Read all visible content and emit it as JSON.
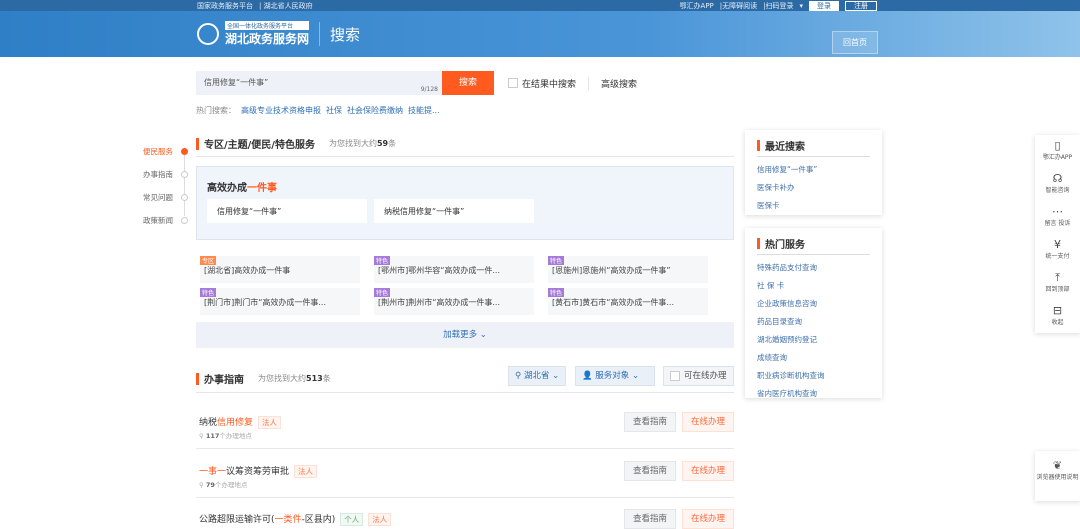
{
  "topbar": {
    "links": [
      "国家政务服务平台",
      "湖北省人民政府"
    ],
    "app": "鄂汇办APP",
    "access": "无障碍阅读",
    "scan": "扫码登录",
    "login": "登录",
    "register": "注册"
  },
  "header": {
    "platform": "全国一体化政务服务平台",
    "site": "湖北政务服务网",
    "page": "搜索",
    "home": "回首页"
  },
  "search": {
    "value": "信用修复“一件事”",
    "count": "9/128",
    "button": "搜索",
    "in_results": "在结果中搜索",
    "advanced": "高级搜索"
  },
  "hot": {
    "label": "热门搜索：",
    "items": [
      "高级专业技术资格申报",
      "社保",
      "社会保险费缴纳",
      "技能提..."
    ]
  },
  "side_nav": [
    "便民服务",
    "办事指南",
    "常见问题",
    "政策新闻"
  ],
  "special": {
    "title": "专区/主题/便民/特色服务",
    "count_pre": "为您找到大约",
    "count": "59",
    "count_suf": "条",
    "banner_title": "高效办成",
    "banner_title_hl": "一件事",
    "cards": [
      "信用修复“一件事”",
      "纳税信用修复“一件事”"
    ],
    "items": [
      {
        "tag": "专区",
        "text": "[湖北省]高效办成一件事"
      },
      {
        "tag": "特色",
        "text": "[鄂州市]鄂州华容“高效办成一件..."
      },
      {
        "tag": "特色",
        "text": "[恩施州]恩施州“高效办成一件事”"
      },
      {
        "tag": "特色",
        "text": "[荆门市]荆门市“高效办成一件事..."
      },
      {
        "tag": "特色",
        "text": "[荆州市]荆州市“高效办成一件事..."
      },
      {
        "tag": "特色",
        "text": "[黄石市]黄石市“高效办成一件事..."
      }
    ],
    "load_more": "加载更多"
  },
  "guide": {
    "title": "办事指南",
    "count_pre": "为您找到大约",
    "count": "513",
    "count_suf": "条",
    "filter_region": "湖北省",
    "filter_target": "服务对象",
    "filter_online": "可在线办理",
    "rows": [
      {
        "pre": "纳税",
        "hl": "信用修复",
        "post": "",
        "tags": [
          "法人"
        ],
        "locs": "117",
        "loc_suf": "个办理地点"
      },
      {
        "pre": "",
        "hl": "一事一",
        "post": "议筹资筹劳审批",
        "tags": [
          "法人"
        ],
        "locs": "79",
        "loc_suf": "个办理地点"
      },
      {
        "pre": "公路超限运输许可(",
        "hl": "一类件",
        "post": "-区县内)",
        "tags": [
          "个人",
          "法人"
        ]
      }
    ],
    "view": "查看指南",
    "online": "在线办理"
  },
  "recent": {
    "title": "最近搜索",
    "items": [
      "信用修复“一件事”",
      "医保卡补办",
      "医保卡"
    ]
  },
  "hotservice": {
    "title": "热门服务",
    "items": [
      "特殊药品支付查询",
      "社 保 卡",
      "企业政策信息咨询",
      "药品目录查询",
      "湖北婚姻预约登记",
      "成绩查询",
      "职业病诊断机构查询",
      "省内医疗机构查询"
    ]
  },
  "float": [
    {
      "icon": "▯",
      "label": "鄂汇办APP"
    },
    {
      "icon": "☊",
      "label": "智能咨询"
    },
    {
      "icon": "⋯",
      "label": "留言 投诉"
    },
    {
      "icon": "¥",
      "label": "统一支付"
    },
    {
      "icon": "⤒",
      "label": "回到顶部"
    },
    {
      "icon": "⊟",
      "label": "收起"
    }
  ],
  "browser": "浏览器使用说明",
  "colors": {
    "accent": "#ff5a1f",
    "link": "#2e6fb5",
    "tag_special": "#ff8a4d",
    "tag_feature": "#a57ad8"
  }
}
